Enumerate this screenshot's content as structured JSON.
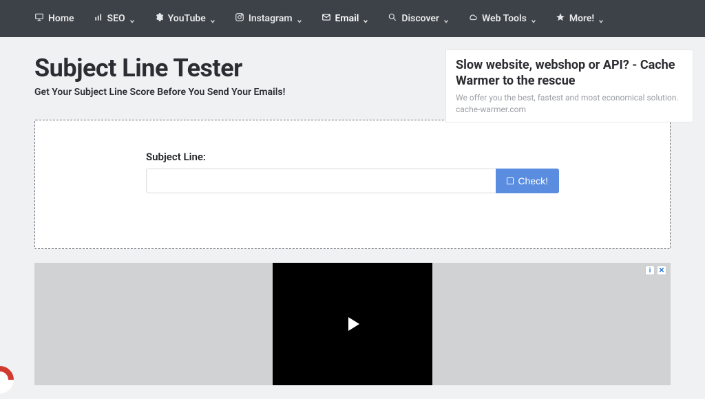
{
  "nav": {
    "items": [
      {
        "label": "Home",
        "icon": "monitor",
        "dropdown": false,
        "active": false
      },
      {
        "label": "SEO",
        "icon": "chart",
        "dropdown": true,
        "active": false
      },
      {
        "label": "YouTube",
        "icon": "gear",
        "dropdown": true,
        "active": false
      },
      {
        "label": "Instagram",
        "icon": "camera",
        "dropdown": true,
        "active": false
      },
      {
        "label": "Email",
        "icon": "mail",
        "dropdown": true,
        "active": true
      },
      {
        "label": "Discover",
        "icon": "search",
        "dropdown": true,
        "active": false
      },
      {
        "label": "Web Tools",
        "icon": "cloud",
        "dropdown": true,
        "active": false
      },
      {
        "label": "More!",
        "icon": "star",
        "dropdown": true,
        "active": false
      }
    ]
  },
  "page": {
    "title": "Subject Line Tester",
    "subtitle": "Get Your Subject Line Score Before You Send Your Emails!"
  },
  "ad_card": {
    "title": "Slow website, webshop or API? - Cache Warmer to the rescue",
    "description": "We offer you the best, fastest and most economical solution. cache-warmer.com"
  },
  "form": {
    "label": "Subject Line:",
    "input_value": "",
    "input_placeholder": "",
    "button_label": "Check!"
  },
  "ad_banner": {
    "info_label": "i",
    "close_label": "✕"
  }
}
